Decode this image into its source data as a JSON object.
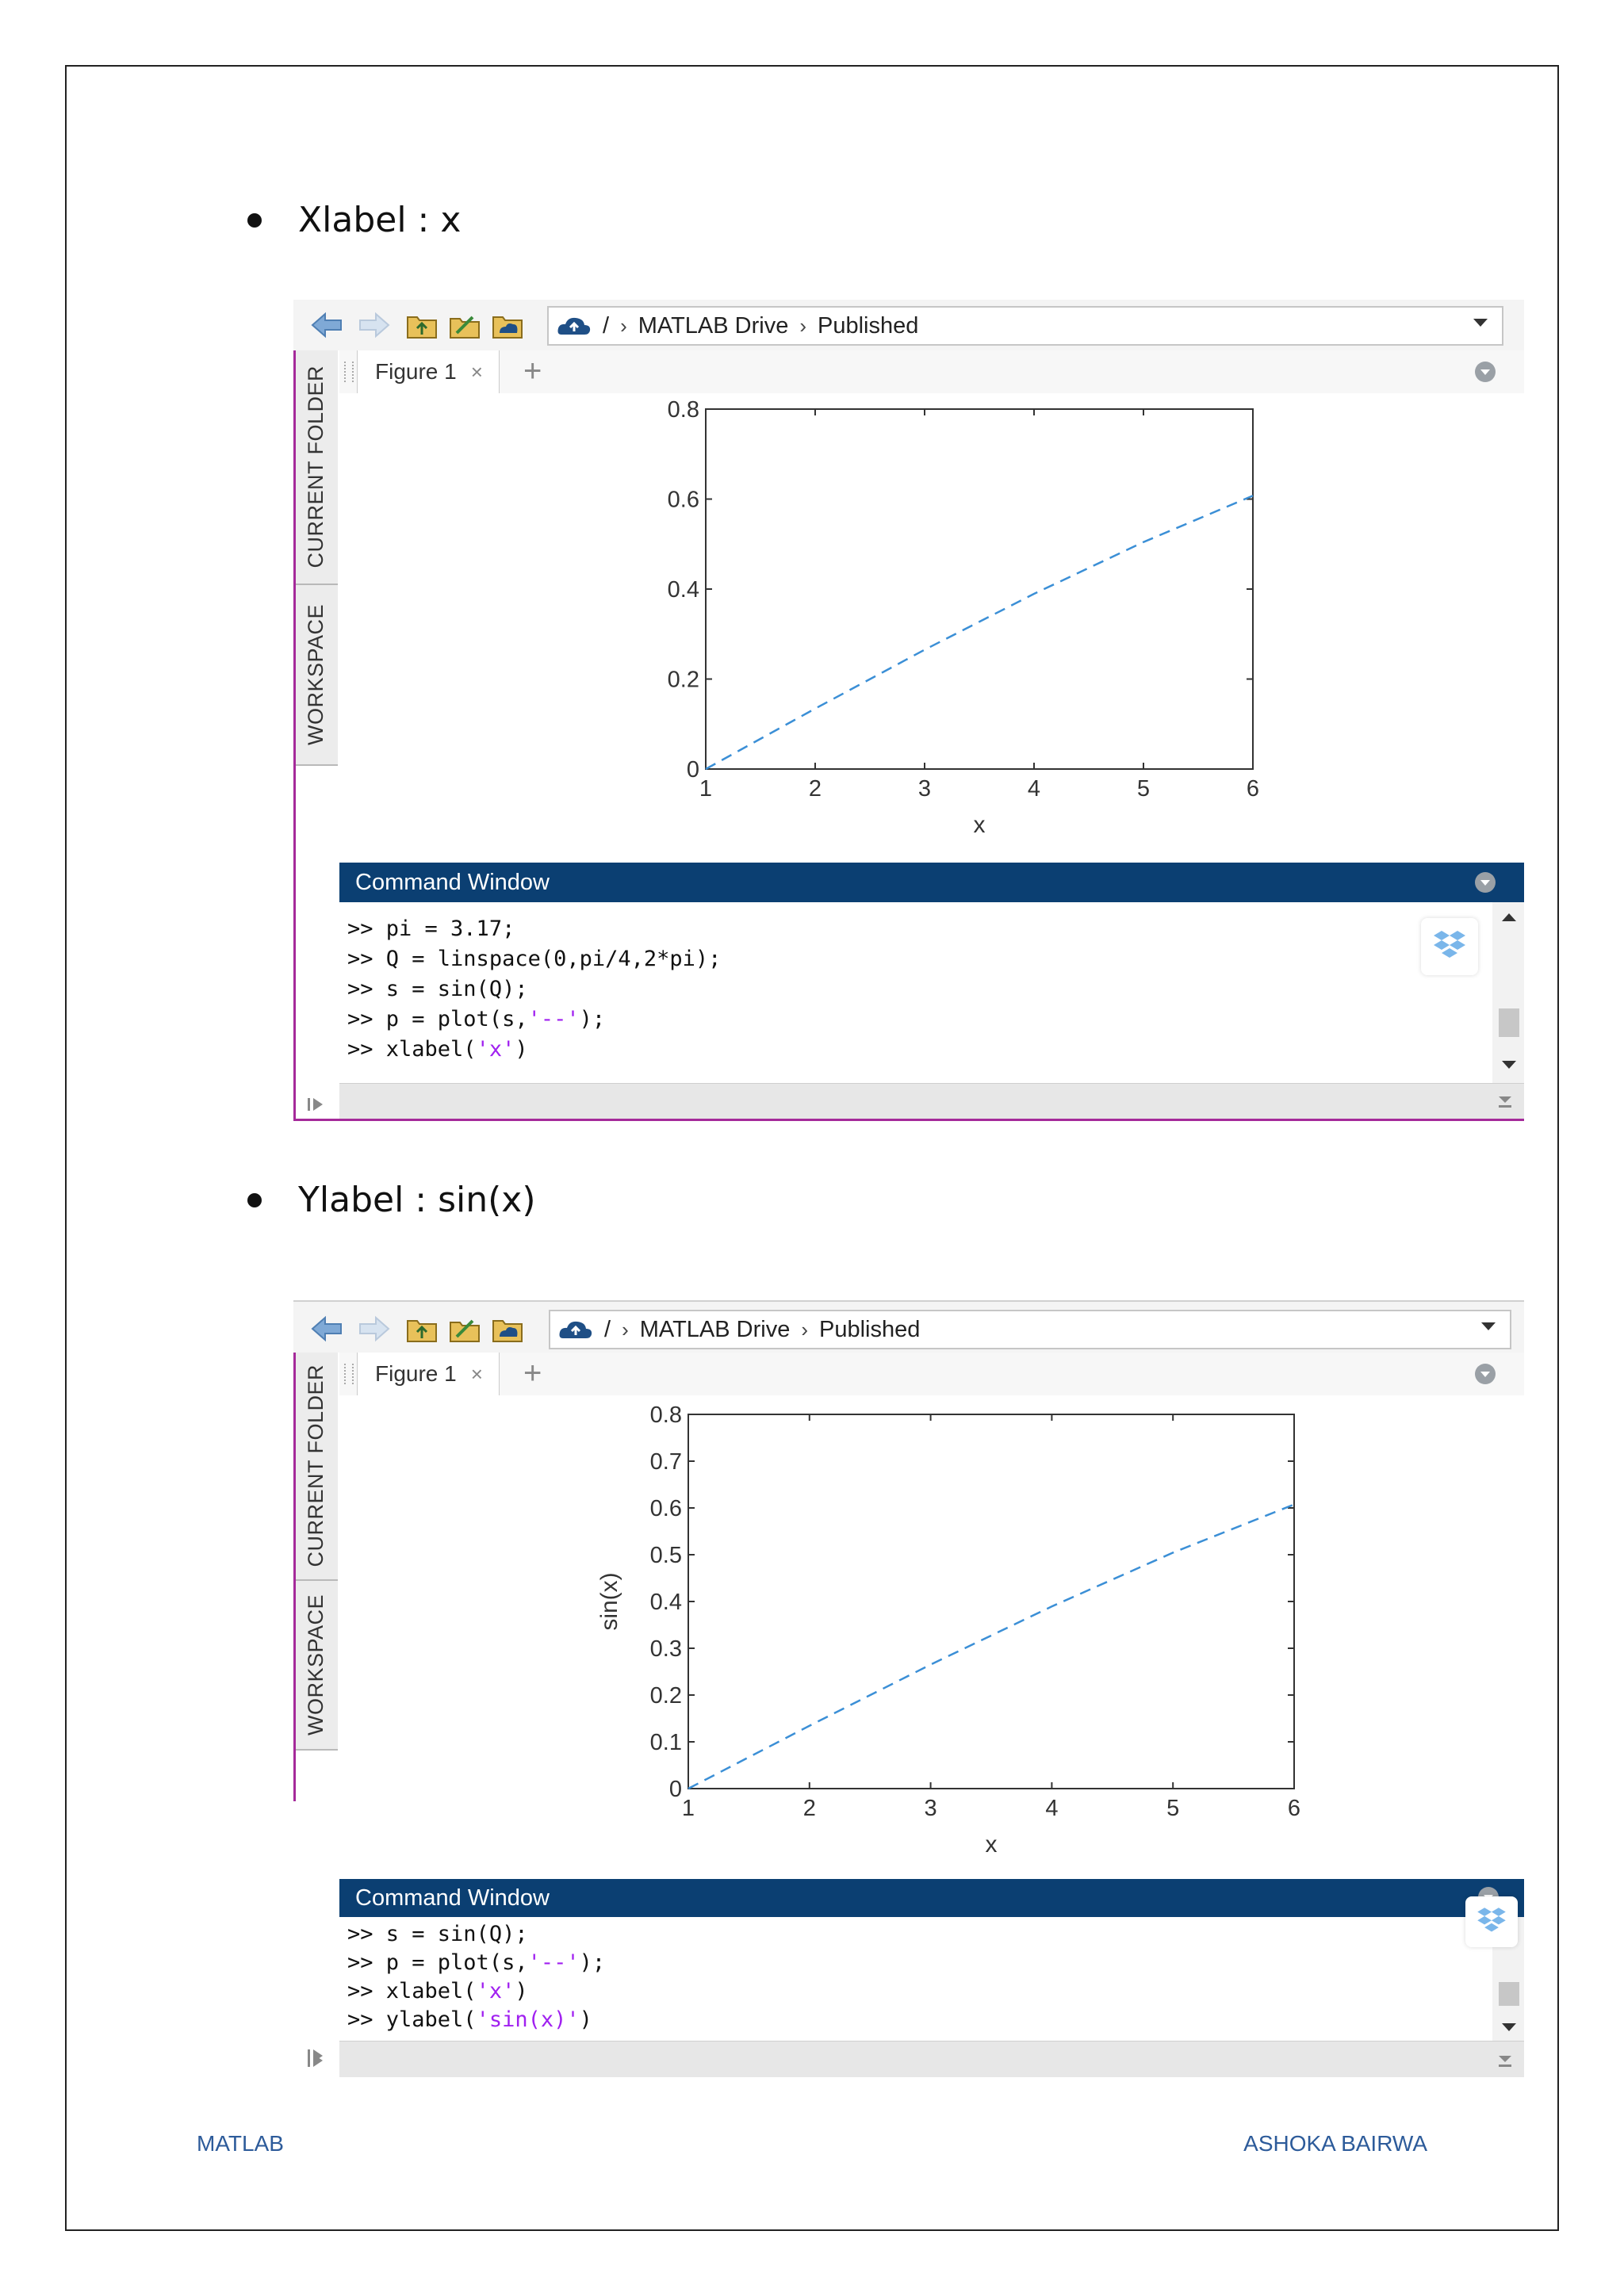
{
  "bullets": [
    "Xlabel : x",
    "Ylabel : sin(x)"
  ],
  "footer": {
    "left": "MATLAB",
    "right": "ASHOKA BAIRWA"
  },
  "colors": {
    "command_bar": "#0b3f72",
    "plot_line": "#3b8fd6",
    "string_literal": "#a020f0",
    "footer_text": "#2d5b9a"
  },
  "screens": [
    {
      "address": {
        "root": "/",
        "crumb1": "MATLAB Drive",
        "crumb2": "Published"
      },
      "sidebar": {
        "tab1": "CURRENT FOLDER",
        "tab2": "WORKSPACE"
      },
      "figure_tab": "Figure 1",
      "close_glyph": "×",
      "plus_glyph": "+",
      "command_title": "Command Window",
      "command_lines": [
        {
          "prompt": ">>",
          "code": " pi = 3.17;",
          "str": "",
          "tail": ""
        },
        {
          "prompt": ">>",
          "code": " Q = linspace(0,pi/4,2*pi);",
          "str": "",
          "tail": ""
        },
        {
          "prompt": ">>",
          "code": " s = sin(Q);",
          "str": "",
          "tail": ""
        },
        {
          "prompt": ">>",
          "code": " p = plot(s,",
          "str": "'--'",
          "tail": ");"
        },
        {
          "prompt": ">>",
          "code": " xlabel(",
          "str": "'x'",
          "tail": ")"
        }
      ]
    },
    {
      "address": {
        "root": "/",
        "crumb1": "MATLAB Drive",
        "crumb2": "Published"
      },
      "sidebar": {
        "tab1": "CURRENT FOLDER",
        "tab2": "WORKSPACE"
      },
      "figure_tab": "Figure 1",
      "close_glyph": "×",
      "plus_glyph": "+",
      "command_title": "Command Window",
      "command_lines": [
        {
          "prompt": ">>",
          "code": " s = sin(Q);",
          "str": "",
          "tail": ""
        },
        {
          "prompt": ">>",
          "code": " p = plot(s,",
          "str": "'--'",
          "tail": ");"
        },
        {
          "prompt": ">>",
          "code": " xlabel(",
          "str": "'x'",
          "tail": ")"
        },
        {
          "prompt": ">>",
          "code": " ylabel(",
          "str": "'sin(x)'",
          "tail": ")"
        }
      ]
    }
  ],
  "chart_data": [
    {
      "type": "line",
      "line_style": "dashed",
      "x": [
        1,
        2,
        3,
        4,
        5,
        6
      ],
      "series": [
        {
          "values": [
            0,
            0.1343,
            0.2651,
            0.3894,
            0.5044,
            0.6075
          ]
        }
      ],
      "xlim": [
        1,
        6
      ],
      "ylim": [
        0,
        0.8
      ],
      "xticks": [
        "1",
        "2",
        "3",
        "4",
        "5",
        "6"
      ],
      "yticks": [
        "0",
        "0.2",
        "0.4",
        "0.6",
        "0.8"
      ],
      "xlabel": "x",
      "ylabel": "",
      "grid": false
    },
    {
      "type": "line",
      "line_style": "dashed",
      "x": [
        1,
        2,
        3,
        4,
        5,
        6
      ],
      "series": [
        {
          "values": [
            0,
            0.1343,
            0.2651,
            0.3894,
            0.5044,
            0.6075
          ]
        }
      ],
      "xlim": [
        1,
        6
      ],
      "ylim": [
        0,
        0.8
      ],
      "xticks": [
        "1",
        "2",
        "3",
        "4",
        "5",
        "6"
      ],
      "yticks": [
        "0",
        "0.1",
        "0.2",
        "0.3",
        "0.4",
        "0.5",
        "0.6",
        "0.7",
        "0.8"
      ],
      "xlabel": "x",
      "ylabel": "sin(x)",
      "grid": false
    }
  ]
}
